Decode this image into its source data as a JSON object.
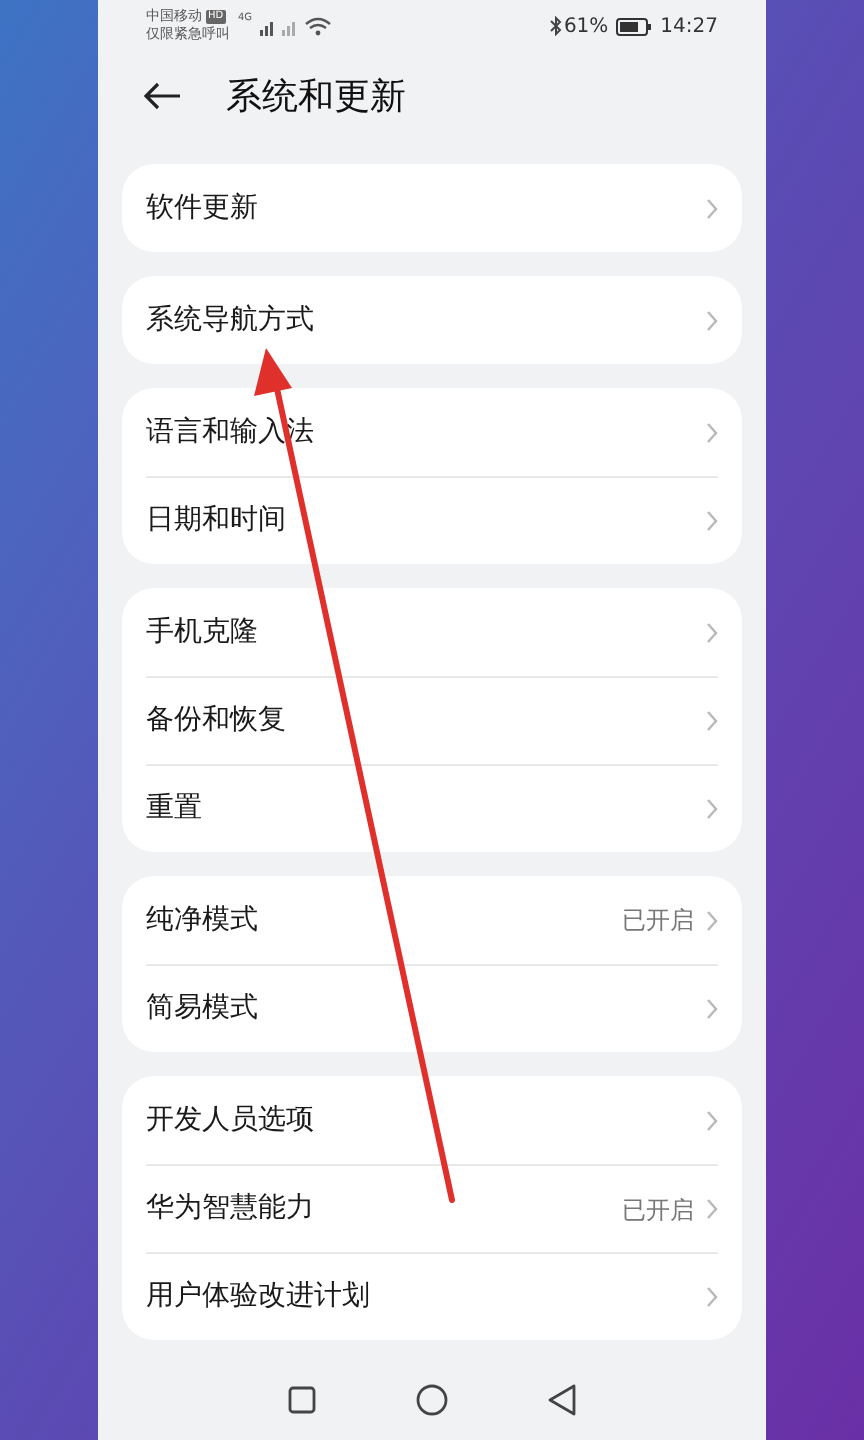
{
  "status_bar": {
    "carrier": "中国移动",
    "carrier_badge": "HD",
    "carrier_note": "仅限紧急呼叫",
    "network": "4G",
    "battery": "61%",
    "time": "14:27"
  },
  "header": {
    "title": "系统和更新"
  },
  "groups": [
    {
      "items": [
        {
          "label": "软件更新"
        }
      ]
    },
    {
      "items": [
        {
          "label": "系统导航方式"
        }
      ]
    },
    {
      "items": [
        {
          "label": "语言和输入法"
        },
        {
          "label": "日期和时间"
        }
      ]
    },
    {
      "items": [
        {
          "label": "手机克隆"
        },
        {
          "label": "备份和恢复"
        },
        {
          "label": "重置"
        }
      ]
    },
    {
      "items": [
        {
          "label": "纯净模式",
          "value": "已开启"
        },
        {
          "label": "简易模式"
        }
      ]
    },
    {
      "items": [
        {
          "label": "开发人员选项"
        },
        {
          "label": "华为智慧能力",
          "value": "已开启"
        },
        {
          "label": "用户体验改进计划"
        }
      ]
    }
  ]
}
